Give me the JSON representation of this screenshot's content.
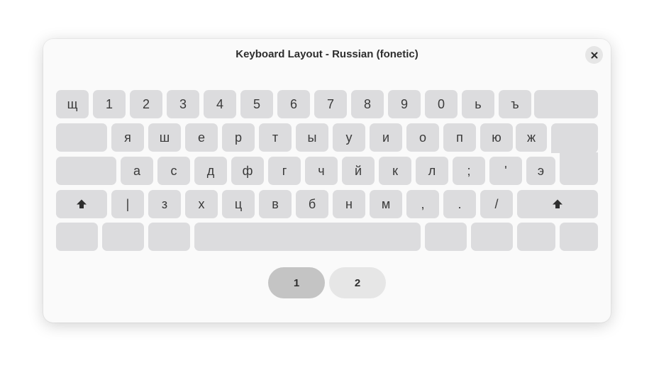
{
  "dialog": {
    "title": "Keyboard Layout - Russian (fonetic)",
    "close_icon": "close-icon"
  },
  "keyboard": {
    "row1": [
      "щ",
      "1",
      "2",
      "3",
      "4",
      "5",
      "6",
      "7",
      "8",
      "9",
      "0",
      "ь",
      "ъ",
      ""
    ],
    "row2": [
      "",
      "я",
      "ш",
      "е",
      "р",
      "т",
      "ы",
      "у",
      "и",
      "о",
      "п",
      "ю",
      "ж"
    ],
    "row3": [
      "",
      "а",
      "с",
      "д",
      "ф",
      "г",
      "ч",
      "й",
      "к",
      "л",
      ";",
      "'",
      "э"
    ],
    "row4": [
      "shift-icon",
      "|",
      "з",
      "х",
      "ц",
      "в",
      "б",
      "н",
      "м",
      ",",
      ".",
      "/",
      "shift-icon"
    ],
    "row5": [
      "",
      "",
      "",
      "",
      "",
      "",
      "",
      ""
    ]
  },
  "pages": {
    "items": [
      "1",
      "2"
    ],
    "active": "1"
  }
}
